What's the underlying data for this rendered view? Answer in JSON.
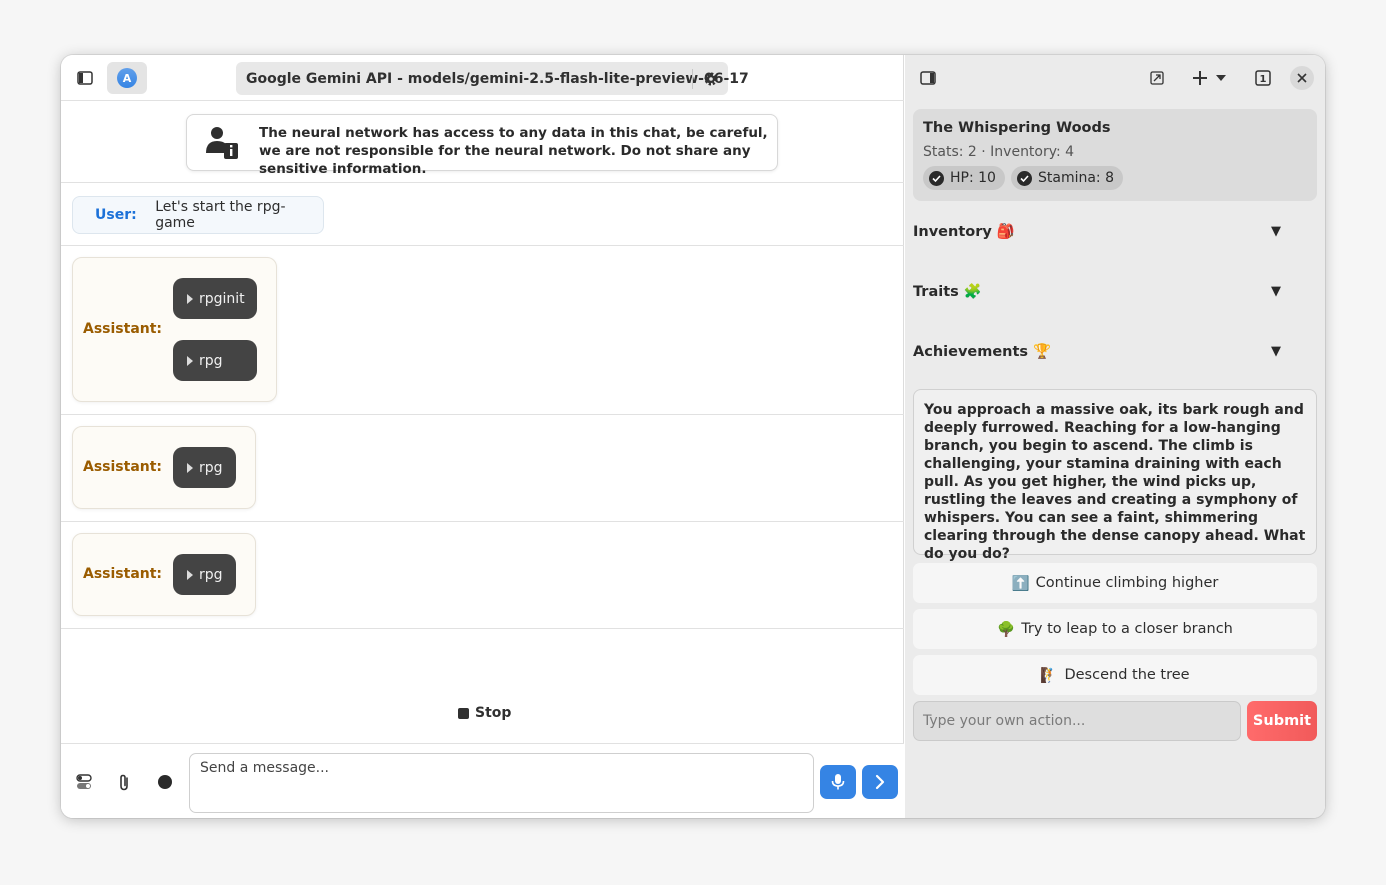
{
  "header": {
    "avatar_letter": "A",
    "model_label": "Google Gemini API - models/gemini-2.5-flash-lite-preview-06-17"
  },
  "notice": {
    "text": "The neural network has access to any data in this chat, be careful, we are not responsible for the neural network. Do not share any sensitive information."
  },
  "messages": [
    {
      "role_label": "User:",
      "text": "Let's start the rpg-game"
    },
    {
      "role_label": "Assistant:",
      "tools": [
        "rpginit",
        "rpg"
      ]
    },
    {
      "role_label": "Assistant:",
      "tools": [
        "rpg"
      ]
    },
    {
      "role_label": "Assistant:",
      "tools": [
        "rpg"
      ]
    }
  ],
  "stop_label": "Stop",
  "composer": {
    "placeholder": "Send a message..."
  },
  "game": {
    "title": "The Whispering Woods",
    "stats_line": "Stats: 2 · Inventory: 4",
    "chips": [
      "HP: 10",
      "Stamina: 8"
    ],
    "sections": [
      {
        "label": "Inventory 🎒",
        "arrow": "▼"
      },
      {
        "label": "Traits 🧩",
        "arrow": "▼"
      },
      {
        "label": "Achievements 🏆",
        "arrow": "▼"
      }
    ],
    "story": "You approach a massive oak, its bark rough and deeply furrowed. Reaching for a low-hanging branch, you begin to ascend. The climb is challenging, your stamina draining with each pull. As you get higher, the wind picks up, rustling the leaves and creating a symphony of whispers. You can see a faint, shimmering clearing through the dense canopy ahead. What do you do?",
    "choices": [
      {
        "emoji": "⬆️",
        "label": "Continue climbing higher"
      },
      {
        "emoji": "🌳",
        "label": "Try to leap to a closer branch"
      },
      {
        "emoji": "🧗",
        "label": "Descend the tree"
      }
    ],
    "action_placeholder": "Type your own action...",
    "submit_label": "Submit"
  },
  "colors": {
    "accent": "#3584e4",
    "user_label": "#1c71d8",
    "assistant_label": "#9a5c00",
    "submit": "#f15a5a"
  }
}
